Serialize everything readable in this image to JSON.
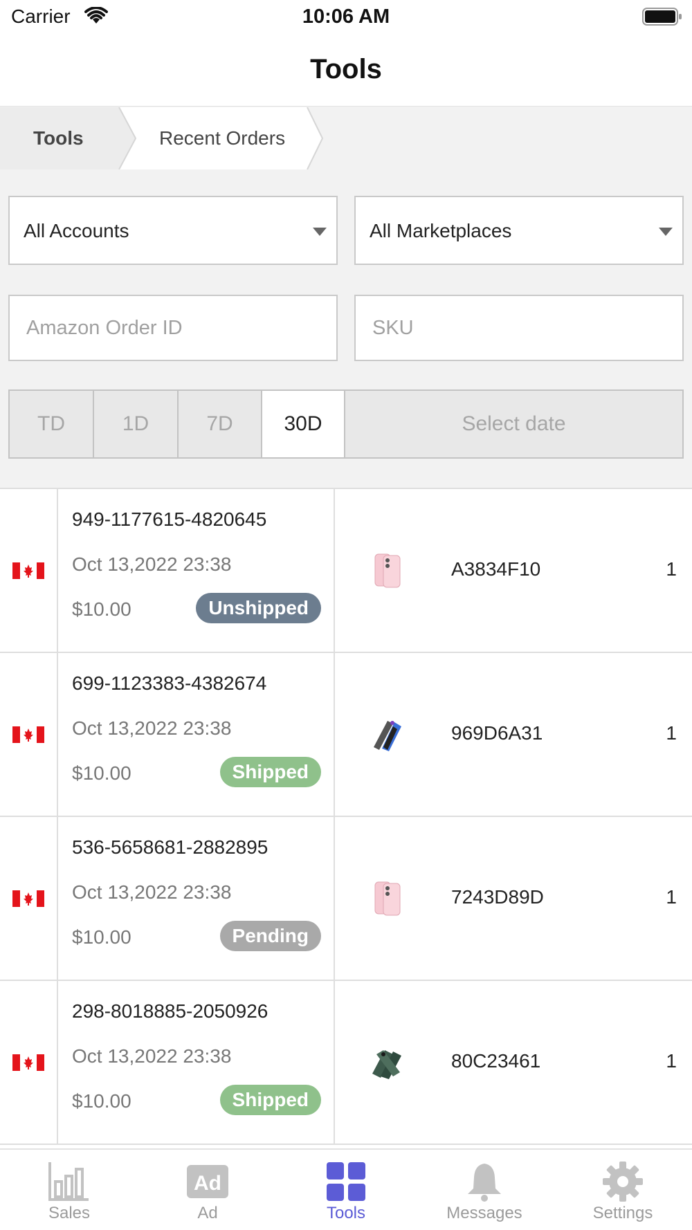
{
  "status_bar": {
    "carrier": "Carrier",
    "time": "10:06 AM"
  },
  "nav": {
    "title": "Tools"
  },
  "breadcrumb": [
    "Tools",
    "Recent Orders"
  ],
  "filters": {
    "account": "All Accounts",
    "marketplace": "All Marketplaces",
    "order_id_placeholder": "Amazon Order ID",
    "sku_placeholder": "SKU"
  },
  "date_range": {
    "options": [
      "TD",
      "1D",
      "7D",
      "30D"
    ],
    "selected": "30D",
    "custom": "Select date"
  },
  "orders": [
    {
      "id": "949-1177615-4820645",
      "date": "Oct 13,2022 23:38",
      "price": "$10.00",
      "status": "Unshipped",
      "sku": "A3834F10",
      "qty": "1",
      "product": "pink-phone"
    },
    {
      "id": "699-1123383-4382674",
      "date": "Oct 13,2022 23:38",
      "price": "$10.00",
      "status": "Shipped",
      "sku": "969D6A31",
      "qty": "1",
      "product": "dark-phone"
    },
    {
      "id": "536-5658681-2882895",
      "date": "Oct 13,2022 23:38",
      "price": "$10.00",
      "status": "Pending",
      "sku": "7243D89D",
      "qty": "1",
      "product": "pink-phone"
    },
    {
      "id": "298-8018885-2050926",
      "date": "Oct 13,2022 23:38",
      "price": "$10.00",
      "status": "Shipped",
      "sku": "80C23461",
      "qty": "1",
      "product": "green-phone"
    }
  ],
  "tabs": [
    {
      "label": "Sales",
      "icon": "bar-chart-icon"
    },
    {
      "label": "Ad",
      "icon": "ad-icon"
    },
    {
      "label": "Tools",
      "icon": "grid-icon",
      "active": true
    },
    {
      "label": "Messages",
      "icon": "bell-icon"
    },
    {
      "label": "Settings",
      "icon": "gear-icon"
    }
  ],
  "colors": {
    "accent": "#5c5cd6",
    "unshipped": "#6c7d8f",
    "shipped": "#8fc18b",
    "pending": "#a9a9a9",
    "flag_red": "#e4141b"
  }
}
